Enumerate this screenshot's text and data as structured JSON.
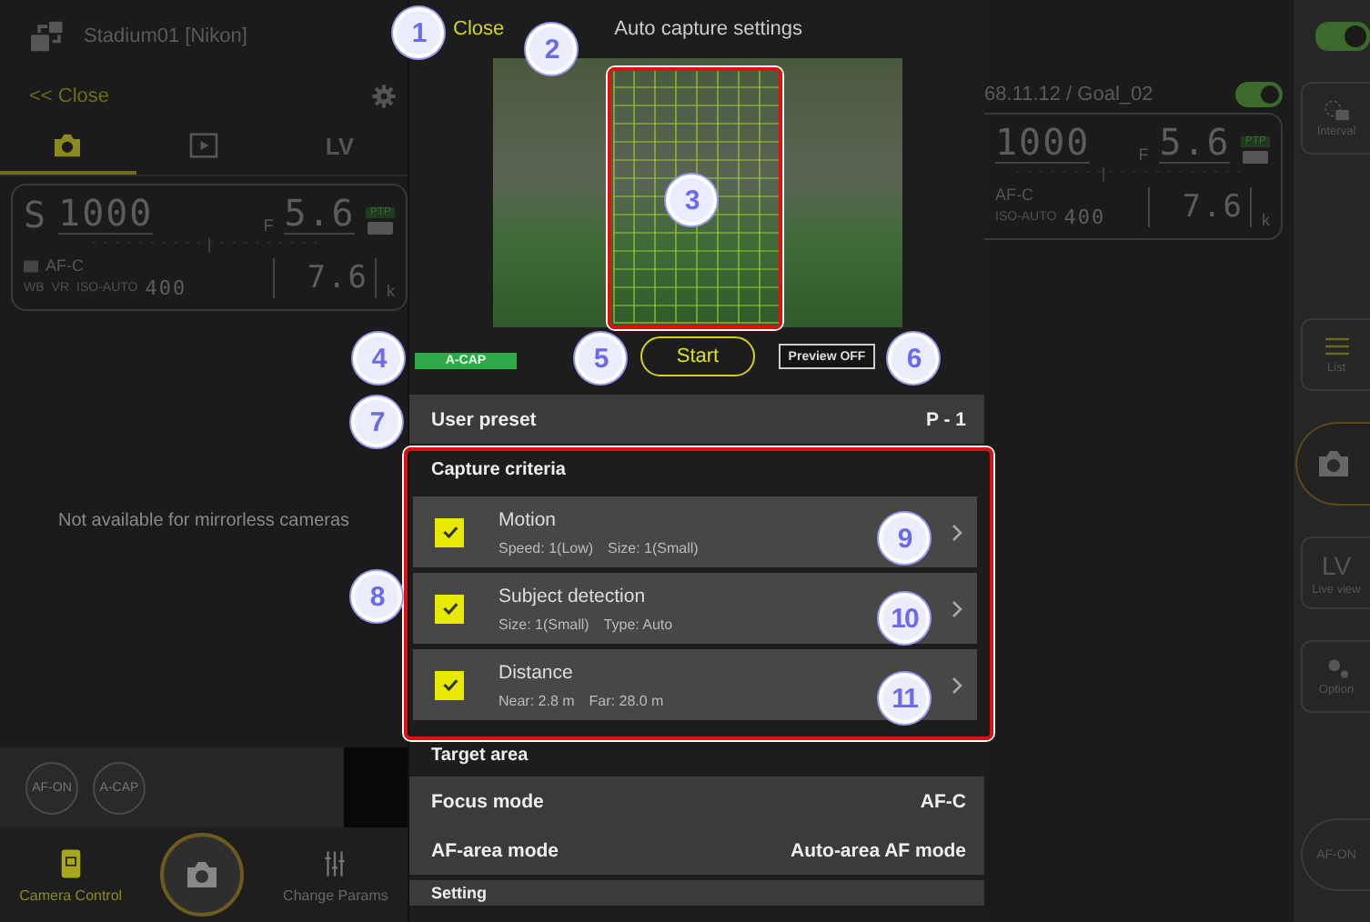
{
  "left_panel": {
    "connection": "Stadium01 [Nikon]",
    "close": "<< Close",
    "tabs": [
      {
        "kind": "camera",
        "selected": true
      },
      {
        "kind": "play",
        "selected": false
      },
      {
        "kind": "text",
        "label": "LV",
        "selected": false
      }
    ],
    "info": {
      "mode": "S",
      "shutter": "1000",
      "aperture_prefix": "F",
      "aperture": "5.6",
      "badge": "PTP",
      "focus": "AF-C",
      "wb": "WB",
      "vr": "VR",
      "iso_label": "ISO-AUTO",
      "iso": "400",
      "remaining": "7.6",
      "remaining_unit": "k"
    },
    "message": "Not available for mirrorless cameras",
    "quick_buttons": [
      "AF-ON",
      "A-CAP"
    ],
    "bottom_tabs": [
      {
        "label": "Camera Control",
        "selected": true
      },
      {
        "label": "Change Params",
        "selected": false
      }
    ]
  },
  "dialog": {
    "close": "Close",
    "title": "Auto capture settings",
    "badge": "A-CAP",
    "start": "Start",
    "preview": "Preview OFF",
    "preset": {
      "label": "User preset",
      "value": "P - 1"
    },
    "criteria_header": "Capture criteria",
    "criteria": [
      {
        "title": "Motion",
        "details": [
          "Speed: 1(Low)",
          "Size: 1(Small)"
        ],
        "checked": true
      },
      {
        "title": "Subject detection",
        "details": [
          "Size: 1(Small)",
          "Type: Auto"
        ],
        "checked": true
      },
      {
        "title": "Distance",
        "details": [
          "Near: 2.8 m",
          "Far: 28.0 m"
        ],
        "checked": true
      }
    ],
    "target_header": "Target area",
    "settings": [
      {
        "label": "Focus mode",
        "value": "AF-C"
      },
      {
        "label": "AF-area mode",
        "value": "Auto-area AF mode"
      }
    ],
    "setting_row": "Setting"
  },
  "right_panel": {
    "file": "68.11.12 / Goal_02",
    "toggle_on": true,
    "info": {
      "shutter": "1000",
      "aperture_prefix": "F",
      "aperture": "5.6",
      "badge": "PTP",
      "focus": "AF-C",
      "iso_label": "ISO-AUTO",
      "iso": "400",
      "remaining": "7.6",
      "remaining_unit": "k"
    }
  },
  "side_strip": {
    "toggle_on": true,
    "buttons": [
      {
        "kind": "interval",
        "label": "Interval"
      },
      {
        "kind": "list",
        "label": "List"
      },
      {
        "kind": "shutter"
      },
      {
        "kind": "lv",
        "glyph": "LV",
        "label": "Live view"
      },
      {
        "kind": "option",
        "label": "Option"
      },
      {
        "kind": "afon",
        "label": "AF-ON"
      }
    ]
  },
  "callouts": [
    "1",
    "2",
    "3",
    "4",
    "5",
    "6",
    "7",
    "8",
    "9",
    "10",
    "11"
  ]
}
